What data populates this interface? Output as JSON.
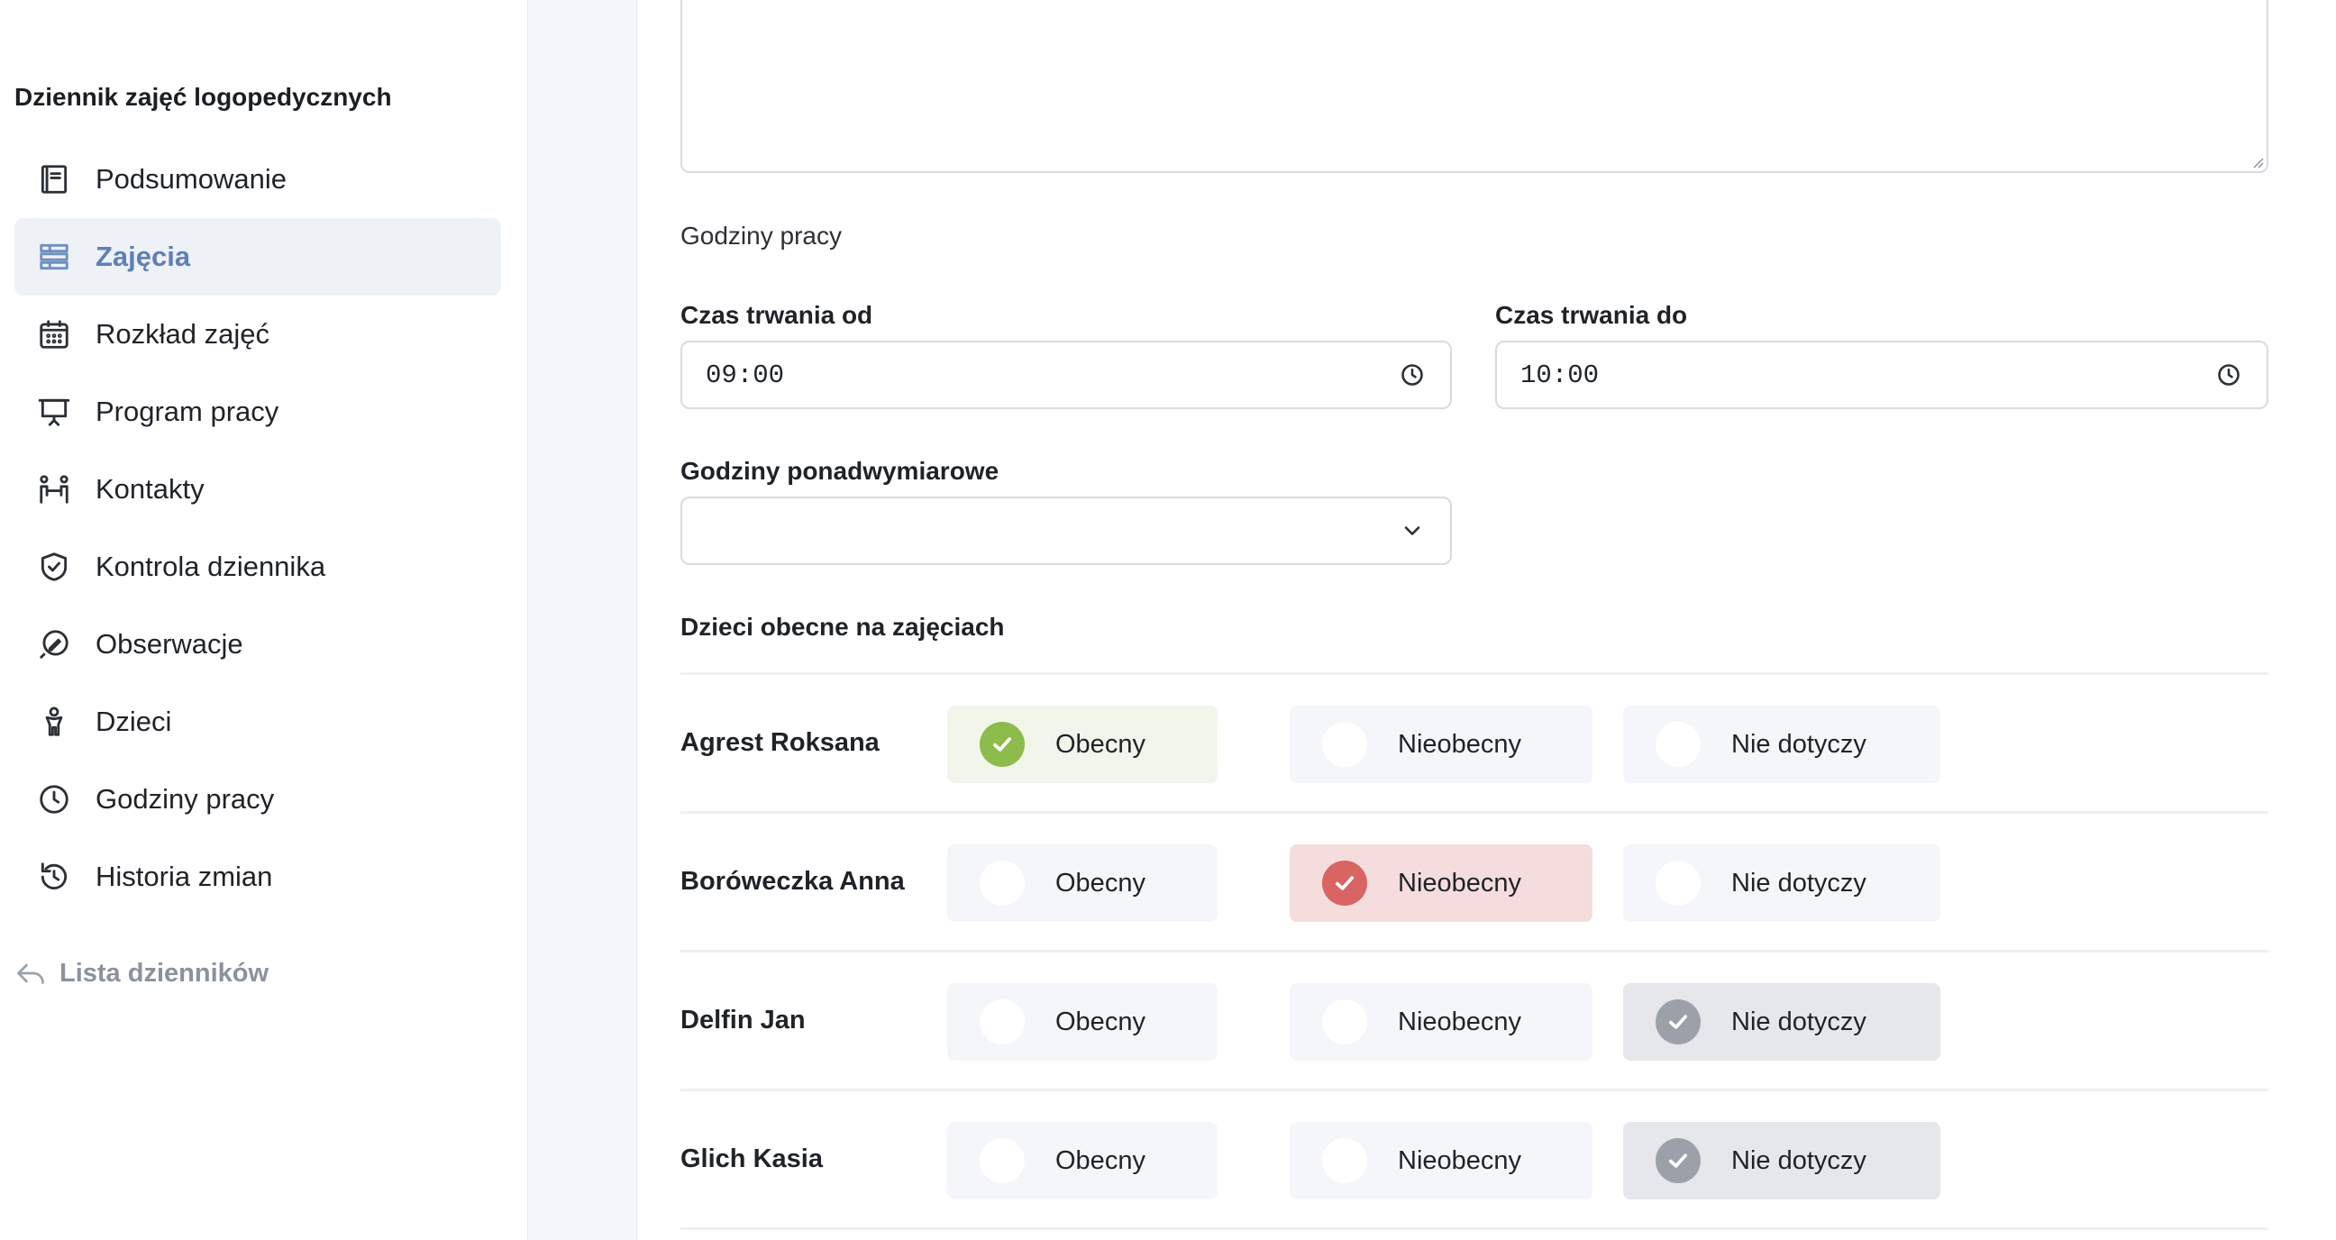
{
  "sidebar": {
    "title": "Dziennik zajęć logopedycznych",
    "items": [
      {
        "label": "Podsumowanie",
        "icon": "book-icon"
      },
      {
        "label": "Zajęcia",
        "icon": "list-icon",
        "active": true
      },
      {
        "label": "Rozkład zajęć",
        "icon": "calendar-icon"
      },
      {
        "label": "Program pracy",
        "icon": "presentation-icon"
      },
      {
        "label": "Kontakty",
        "icon": "people-icon"
      },
      {
        "label": "Kontrola dziennika",
        "icon": "shield-icon"
      },
      {
        "label": "Obserwacje",
        "icon": "pen-icon"
      },
      {
        "label": "Dzieci",
        "icon": "child-icon"
      },
      {
        "label": "Godziny pracy",
        "icon": "clock-icon"
      },
      {
        "label": "Historia zmian",
        "icon": "history-icon"
      }
    ],
    "back_label": "Lista dzienników"
  },
  "form": {
    "hours_section": "Godziny pracy",
    "from_label": "Czas trwania od",
    "from_value": "09:00",
    "to_label": "Czas trwania do",
    "to_value": "10:00",
    "overtime_label": "Godziny ponadwymiarowe",
    "overtime_value": ""
  },
  "attendance": {
    "title": "Dzieci obecne na zajęciach",
    "options": {
      "present": "Obecny",
      "absent": "Nieobecny",
      "na": "Nie dotyczy"
    },
    "rows": [
      {
        "name": "Agrest Roksana",
        "status": "present"
      },
      {
        "name": "Boróweczka Anna",
        "status": "absent"
      },
      {
        "name": "Delfin Jan",
        "status": "na"
      },
      {
        "name": "Glich Kasia",
        "status": "na"
      }
    ]
  },
  "colors": {
    "accent": "#5f80b5",
    "present": "#8dbb4c",
    "absent": "#d96464",
    "not_applicable": "#9ca1a9"
  }
}
